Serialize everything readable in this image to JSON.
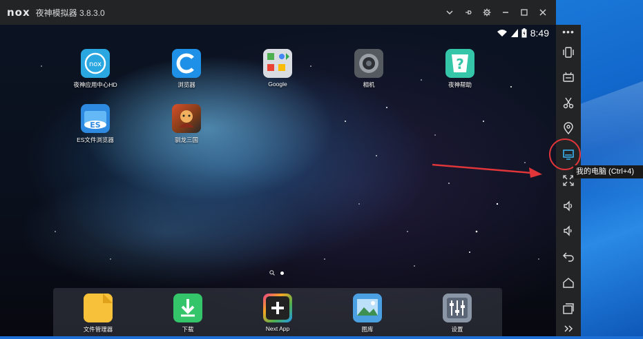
{
  "titlebar": {
    "logo": "nox",
    "title": "夜神模拟器 3.8.3.0"
  },
  "statusbar": {
    "time": "8:49"
  },
  "apps": [
    {
      "label": "夜神应用中心HD",
      "icon": "nox-app-center-icon"
    },
    {
      "label": "浏览器",
      "icon": "browser-icon"
    },
    {
      "label": "Google",
      "icon": "google-folder-icon"
    },
    {
      "label": "相机",
      "icon": "camera-icon"
    },
    {
      "label": "夜神帮助",
      "icon": "help-icon"
    },
    {
      "label": "ES文件浏览器",
      "icon": "es-file-explorer-icon"
    },
    {
      "label": "驯龙三国",
      "icon": "game-icon"
    }
  ],
  "dock": [
    {
      "label": "文件管理器",
      "icon": "folder-icon"
    },
    {
      "label": "下载",
      "icon": "download-icon"
    },
    {
      "label": "Next App",
      "icon": "plus-icon"
    },
    {
      "label": "图库",
      "icon": "gallery-icon"
    },
    {
      "label": "设置",
      "icon": "settings-icon"
    }
  ],
  "toolbar": {
    "tooltip": "我的电脑 (Ctrl+4)"
  },
  "colors": {
    "highlight": "#e0363a",
    "active_tool": "#3ab4f2",
    "titlebar": "#222426"
  }
}
